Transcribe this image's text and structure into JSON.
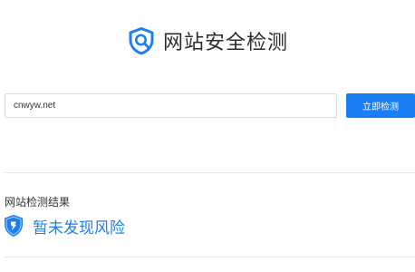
{
  "header": {
    "logo_icon": "shield-search-icon",
    "title": "网站安全检测"
  },
  "search": {
    "value": "cnwyw.net",
    "button_label": "立即检测"
  },
  "result": {
    "heading": "网站检测结果",
    "status_icon": "shield-check-icon",
    "status_text": "暂未发现风险"
  },
  "colors": {
    "accent": "#1a7ef4",
    "divider": "#e6e6e6",
    "input_border": "#dcdcdc"
  }
}
